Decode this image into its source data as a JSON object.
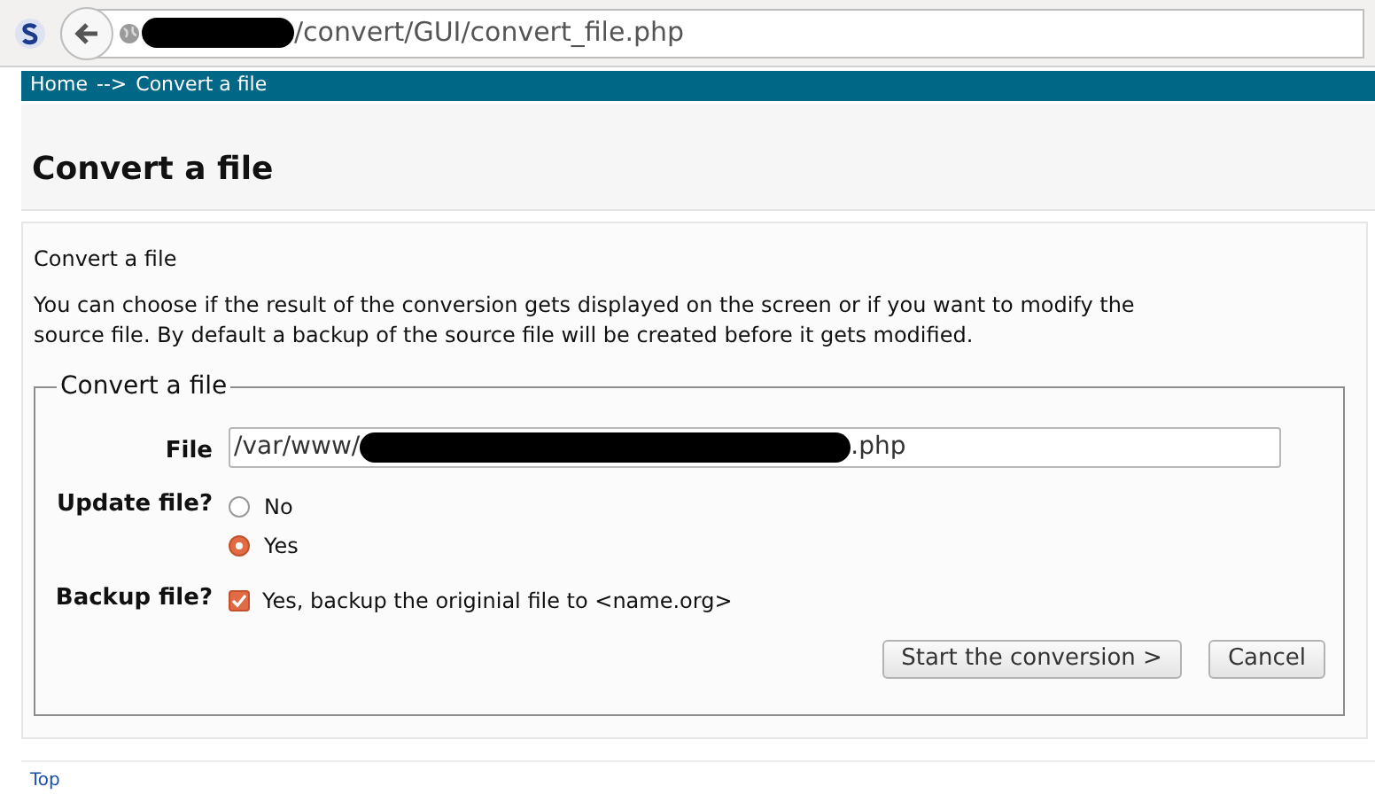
{
  "browser": {
    "url_path": "/convert/GUI/convert_file.php"
  },
  "breadcrumb": {
    "items": [
      "Home",
      "-->",
      "Convert a file"
    ]
  },
  "page_title": "Convert a file",
  "content": {
    "heading": "Convert a file",
    "description": "You can choose if the result of the conversion gets displayed on the screen or if you want to modify the source file. By default a backup of the source file will be created before it gets modified."
  },
  "form": {
    "legend": "Convert a file",
    "file": {
      "label": "File",
      "value_start": "/var/www/",
      "value_end": ".php"
    },
    "update": {
      "label": "Update file?",
      "options": [
        {
          "label": "No",
          "selected": false
        },
        {
          "label": "Yes",
          "selected": true
        }
      ]
    },
    "backup": {
      "label": "Backup file?",
      "option": "Yes, backup the originial file to <name.org>",
      "checked": true
    },
    "buttons": [
      "Start the conversion >",
      "Cancel"
    ]
  },
  "footer": {
    "link": "Top"
  }
}
